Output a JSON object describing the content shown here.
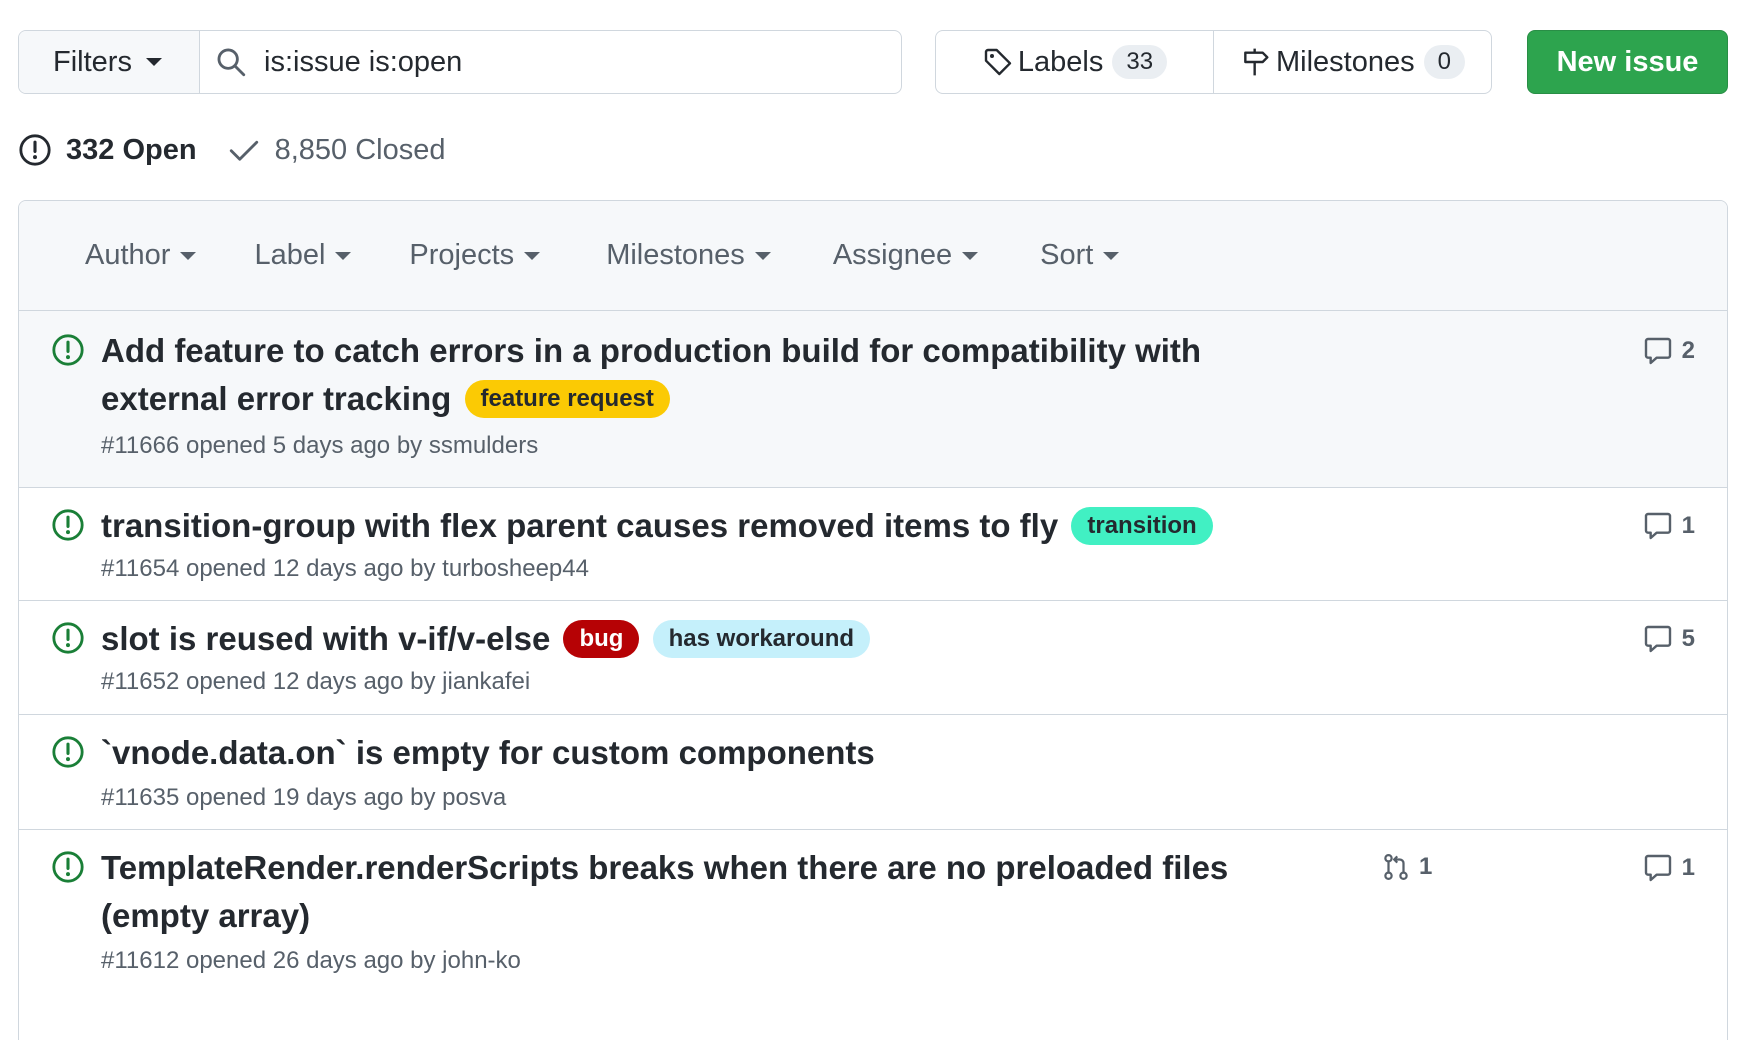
{
  "toolbar": {
    "filters_label": "Filters",
    "search_value": "is:issue is:open",
    "labels_label": "Labels",
    "labels_count": "33",
    "milestones_label": "Milestones",
    "milestones_count": "0",
    "new_issue_label": "New issue"
  },
  "states": {
    "open_label": "332 Open",
    "closed_label": "8,850 Closed"
  },
  "header": {
    "author": "Author",
    "label": "Label",
    "projects": "Projects",
    "milestones": "Milestones",
    "assignee": "Assignee",
    "sort": "Sort"
  },
  "colors": {
    "open_icon": "#1a7f37",
    "primary_button": "#2da44e"
  },
  "issues": [
    {
      "title_line1": "Add feature to catch errors in a production build for compatibility with",
      "title_line2": "external error tracking",
      "labels": [
        {
          "text": "feature request",
          "bg": "#fbca04",
          "fg": "#24292f"
        }
      ],
      "meta": "#11666 opened 5 days ago by ssmulders",
      "comments": "2",
      "linked_prs": ""
    },
    {
      "title_line1": "transition-group with flex parent causes removed items to fly",
      "labels": [
        {
          "text": "transition",
          "bg": "#41f0c3",
          "fg": "#24292f"
        }
      ],
      "meta": "#11654 opened 12 days ago by turbosheep44",
      "comments": "1",
      "linked_prs": ""
    },
    {
      "title_line1": "slot is reused with v-if/v-else",
      "labels": [
        {
          "text": "bug",
          "bg": "#b60205",
          "fg": "#ffffff"
        },
        {
          "text": "has workaround",
          "bg": "#c5f0fb",
          "fg": "#24292f"
        }
      ],
      "meta": "#11652 opened 12 days ago by jiankafei",
      "comments": "5",
      "linked_prs": ""
    },
    {
      "title_line1": "`vnode.data.on` is empty for custom components",
      "labels": [],
      "meta": "#11635 opened 19 days ago by posva",
      "comments": "",
      "linked_prs": ""
    },
    {
      "title_line1": "TemplateRender.renderScripts breaks when there are no preloaded files",
      "title_line2": "(empty array)",
      "labels": [],
      "meta": "#11612 opened 26 days ago by john-ko",
      "comments": "1",
      "linked_prs": "1"
    }
  ]
}
